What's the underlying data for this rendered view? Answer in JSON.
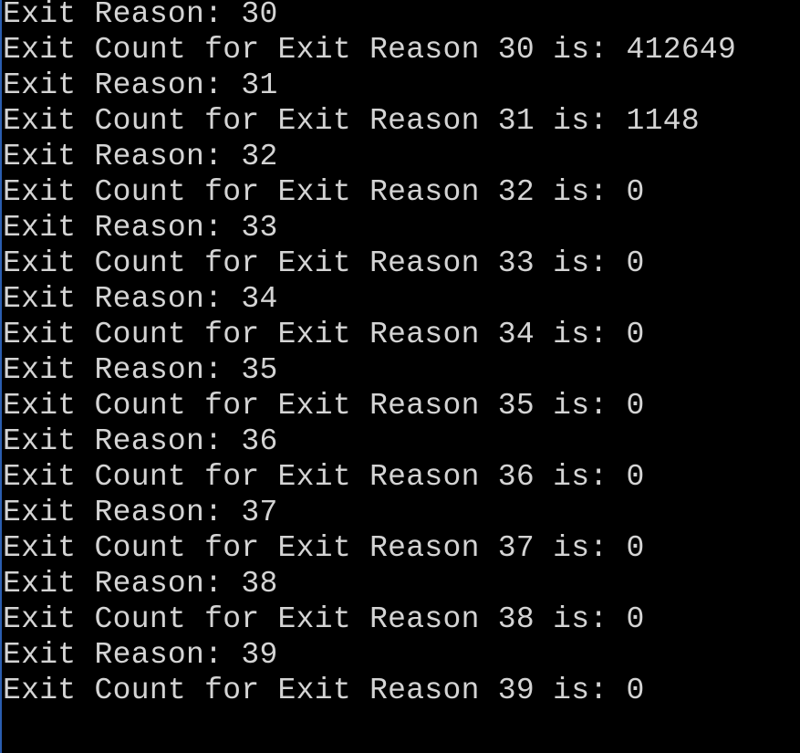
{
  "terminal": {
    "lines": [
      "Exit Reason: 30",
      "Exit Count for Exit Reason 30 is: 412649",
      "Exit Reason: 31",
      "Exit Count for Exit Reason 31 is: 1148",
      "Exit Reason: 32",
      "Exit Count for Exit Reason 32 is: 0",
      "Exit Reason: 33",
      "Exit Count for Exit Reason 33 is: 0",
      "Exit Reason: 34",
      "Exit Count for Exit Reason 34 is: 0",
      "Exit Reason: 35",
      "Exit Count for Exit Reason 35 is: 0",
      "Exit Reason: 36",
      "Exit Count for Exit Reason 36 is: 0",
      "Exit Reason: 37",
      "Exit Count for Exit Reason 37 is: 0",
      "Exit Reason: 38",
      "Exit Count for Exit Reason 38 is: 0",
      "Exit Reason: 39",
      "Exit Count for Exit Reason 39 is: 0"
    ],
    "colors": {
      "background": "#000000",
      "text": "#d4d4d4",
      "edge": "#2a5db0"
    }
  }
}
